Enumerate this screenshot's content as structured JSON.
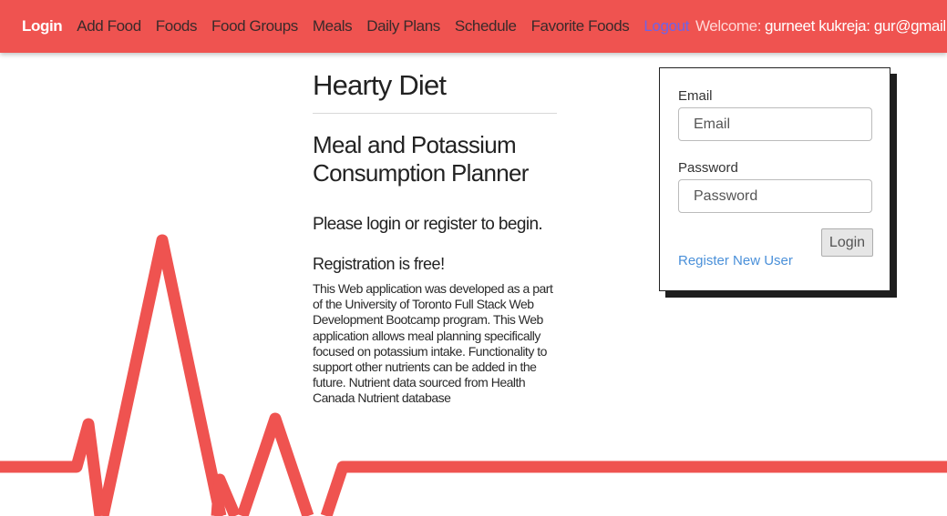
{
  "nav": {
    "links": [
      "Login",
      "Add Food",
      "Foods",
      "Food Groups",
      "Meals",
      "Daily Plans",
      "Schedule",
      "Favorite Foods"
    ],
    "logout": "Logout",
    "welcome_label": "Welcome:",
    "welcome_user": "gurneet kukreja: gur@gmail.com"
  },
  "main": {
    "title": "Hearty Diet",
    "subtitle": "Meal and Potassium Consumption Planner",
    "prompt": "Please login or register to begin.",
    "registration_free": "Registration is free!",
    "description": "This Web application was developed as a part of the University of Toronto Full Stack Web Development Bootcamp program. This Web application allows meal planning specifically focused on potassium intake. Functionality to support other nutrients can be added in the future. Nutrient data sourced from Health Canada Nutrient database"
  },
  "login_form": {
    "email_label": "Email",
    "email_placeholder": "Email",
    "password_label": "Password",
    "password_placeholder": "Password",
    "login_button": "Login",
    "register_link": "Register New User"
  },
  "colors": {
    "brand": "#ef5350",
    "logout_link": "#6f63e6",
    "register_link": "#4a90d9"
  }
}
